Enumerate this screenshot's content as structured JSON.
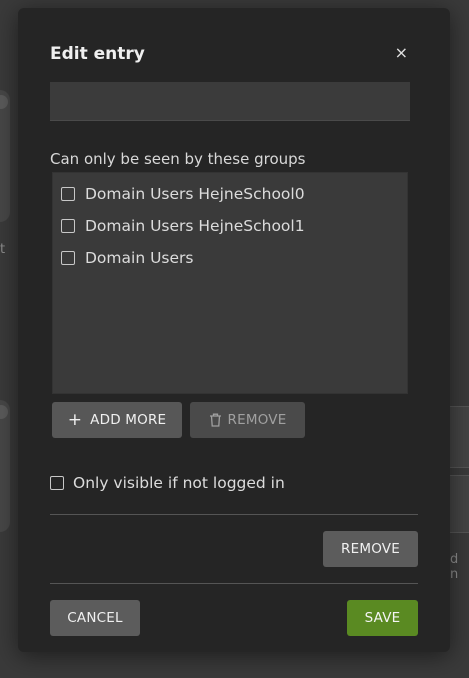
{
  "background": {
    "left_fragment": "t",
    "right_fragment": "d n"
  },
  "modal": {
    "title": "Edit entry",
    "close_glyph": "×",
    "name_input_value": "",
    "groups_label": "Can only be seen by these groups",
    "groups": [
      {
        "label": "Domain Users HejneSchool0",
        "checked": false
      },
      {
        "label": "Domain Users HejneSchool1",
        "checked": false
      },
      {
        "label": "Domain Users",
        "checked": false
      }
    ],
    "add_more_label": "ADD MORE",
    "add_more_icon": "plus-icon",
    "remove_group_label": "REMOVE",
    "remove_group_icon": "trash-icon",
    "only_visible_label": "Only visible if not logged in",
    "only_visible_checked": false,
    "remove_entry_label": "REMOVE",
    "cancel_label": "CANCEL",
    "save_label": "SAVE"
  },
  "colors": {
    "save_accent": "#5a8a22",
    "modal_bg": "#252525",
    "page_bg": "#3a3a3a"
  }
}
